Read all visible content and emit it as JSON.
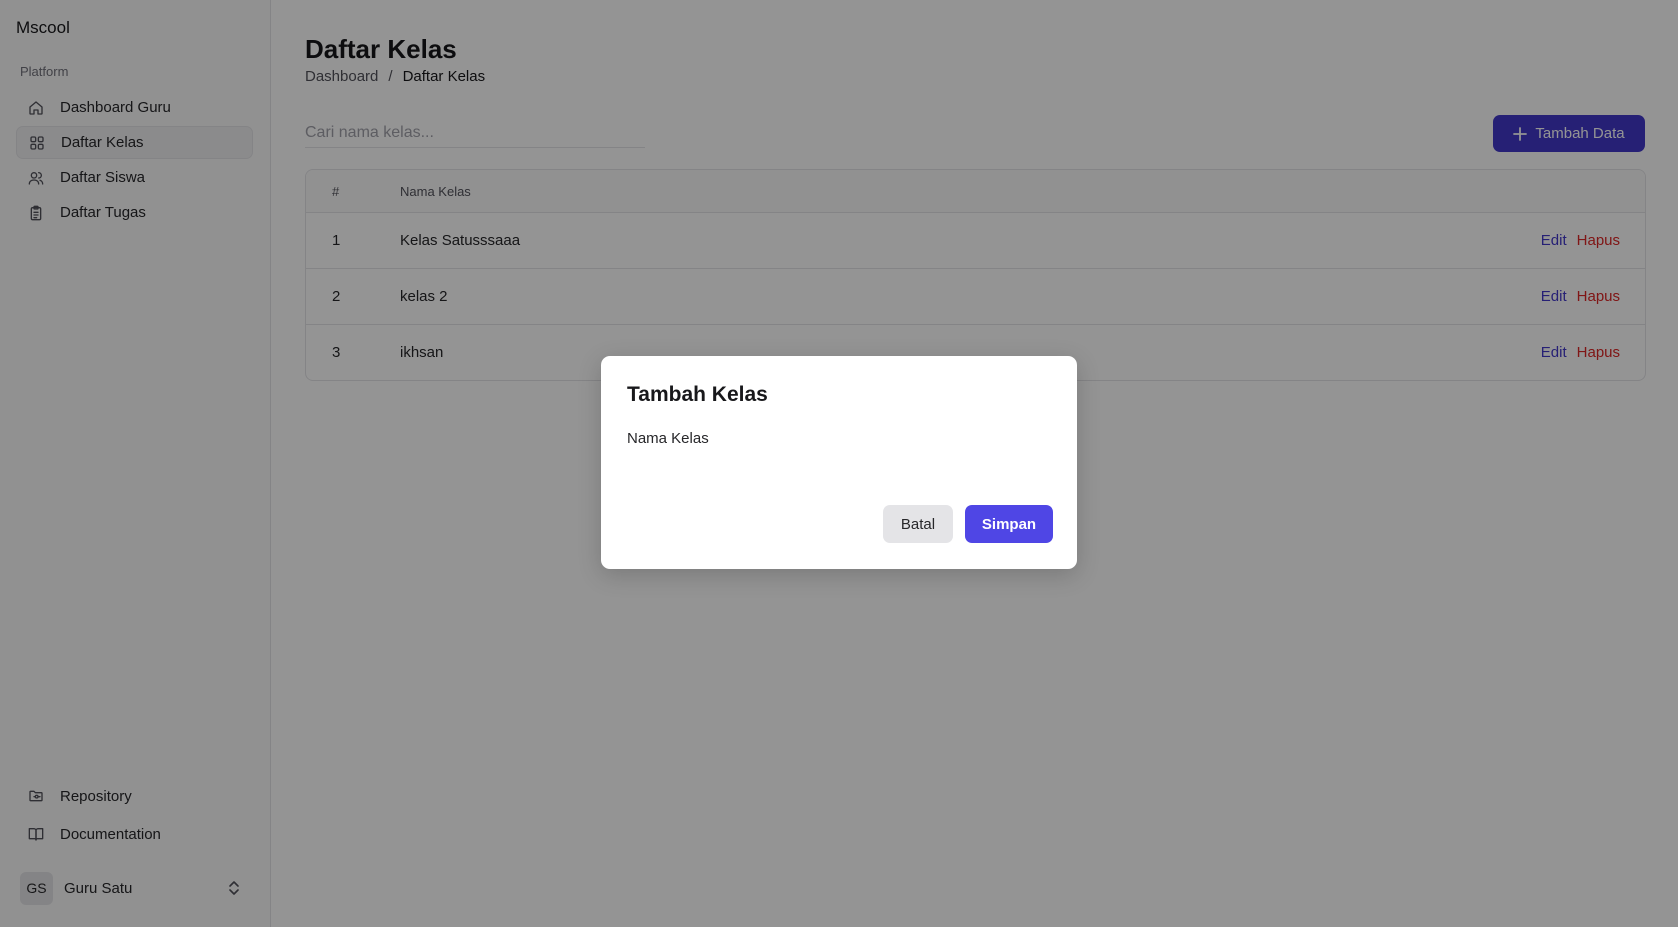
{
  "app": {
    "name": "Mscool"
  },
  "sidebar": {
    "group_label": "Platform",
    "items": [
      {
        "label": "Dashboard Guru",
        "icon": "home-icon",
        "active": false
      },
      {
        "label": "Daftar Kelas",
        "icon": "grid-icon",
        "active": true
      },
      {
        "label": "Daftar Siswa",
        "icon": "users-icon",
        "active": false
      },
      {
        "label": "Daftar Tugas",
        "icon": "clipboard-icon",
        "active": false
      }
    ],
    "bottom_items": [
      {
        "label": "Repository",
        "icon": "folder-git-icon"
      },
      {
        "label": "Documentation",
        "icon": "book-open-icon"
      }
    ],
    "user": {
      "initials": "GS",
      "name": "Guru Satu"
    }
  },
  "page": {
    "title": "Daftar Kelas",
    "breadcrumb": {
      "root": "Dashboard",
      "separator": "/",
      "current": "Daftar Kelas"
    },
    "search": {
      "placeholder": "Cari nama kelas..."
    },
    "add_button": "Tambah Data"
  },
  "table": {
    "headers": {
      "num": "#",
      "name": "Nama Kelas"
    },
    "rows": [
      {
        "num": "1",
        "name": "Kelas Satusssaaa",
        "edit": "Edit",
        "delete": "Hapus"
      },
      {
        "num": "2",
        "name": "kelas 2",
        "edit": "Edit",
        "delete": "Hapus"
      },
      {
        "num": "3",
        "name": "ikhsan",
        "edit": "Edit",
        "delete": "Hapus"
      }
    ]
  },
  "dialog": {
    "title": "Tambah Kelas",
    "field_label": "Nama Kelas",
    "field_value": "",
    "cancel": "Batal",
    "save": "Simpan"
  },
  "colors": {
    "primary": "#4f46e5",
    "primary_dark": "#4338ca",
    "danger": "#dc2626",
    "overlay": "rgba(0,0,0,0.42)"
  }
}
